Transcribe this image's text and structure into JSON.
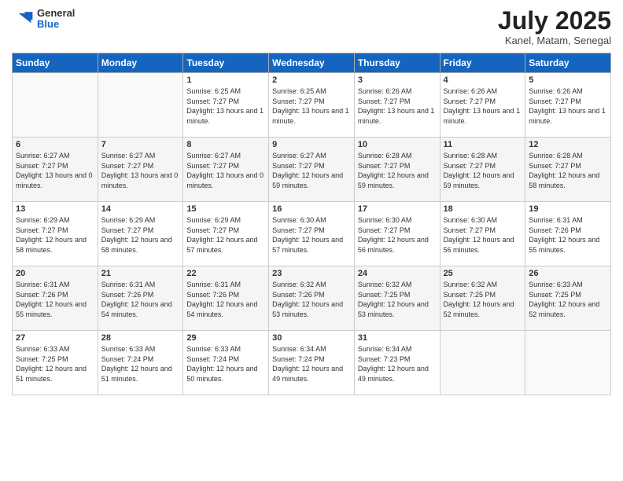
{
  "header": {
    "logo_general": "General",
    "logo_blue": "Blue",
    "month_title": "July 2025",
    "location": "Kanel, Matam, Senegal"
  },
  "weekdays": [
    "Sunday",
    "Monday",
    "Tuesday",
    "Wednesday",
    "Thursday",
    "Friday",
    "Saturday"
  ],
  "weeks": [
    [
      {
        "day": "",
        "info": ""
      },
      {
        "day": "",
        "info": ""
      },
      {
        "day": "1",
        "info": "Sunrise: 6:25 AM\nSunset: 7:27 PM\nDaylight: 13 hours and 1 minute."
      },
      {
        "day": "2",
        "info": "Sunrise: 6:25 AM\nSunset: 7:27 PM\nDaylight: 13 hours and 1 minute."
      },
      {
        "day": "3",
        "info": "Sunrise: 6:26 AM\nSunset: 7:27 PM\nDaylight: 13 hours and 1 minute."
      },
      {
        "day": "4",
        "info": "Sunrise: 6:26 AM\nSunset: 7:27 PM\nDaylight: 13 hours and 1 minute."
      },
      {
        "day": "5",
        "info": "Sunrise: 6:26 AM\nSunset: 7:27 PM\nDaylight: 13 hours and 1 minute."
      }
    ],
    [
      {
        "day": "6",
        "info": "Sunrise: 6:27 AM\nSunset: 7:27 PM\nDaylight: 13 hours and 0 minutes."
      },
      {
        "day": "7",
        "info": "Sunrise: 6:27 AM\nSunset: 7:27 PM\nDaylight: 13 hours and 0 minutes."
      },
      {
        "day": "8",
        "info": "Sunrise: 6:27 AM\nSunset: 7:27 PM\nDaylight: 13 hours and 0 minutes."
      },
      {
        "day": "9",
        "info": "Sunrise: 6:27 AM\nSunset: 7:27 PM\nDaylight: 12 hours and 59 minutes."
      },
      {
        "day": "10",
        "info": "Sunrise: 6:28 AM\nSunset: 7:27 PM\nDaylight: 12 hours and 59 minutes."
      },
      {
        "day": "11",
        "info": "Sunrise: 6:28 AM\nSunset: 7:27 PM\nDaylight: 12 hours and 59 minutes."
      },
      {
        "day": "12",
        "info": "Sunrise: 6:28 AM\nSunset: 7:27 PM\nDaylight: 12 hours and 58 minutes."
      }
    ],
    [
      {
        "day": "13",
        "info": "Sunrise: 6:29 AM\nSunset: 7:27 PM\nDaylight: 12 hours and 58 minutes."
      },
      {
        "day": "14",
        "info": "Sunrise: 6:29 AM\nSunset: 7:27 PM\nDaylight: 12 hours and 58 minutes."
      },
      {
        "day": "15",
        "info": "Sunrise: 6:29 AM\nSunset: 7:27 PM\nDaylight: 12 hours and 57 minutes."
      },
      {
        "day": "16",
        "info": "Sunrise: 6:30 AM\nSunset: 7:27 PM\nDaylight: 12 hours and 57 minutes."
      },
      {
        "day": "17",
        "info": "Sunrise: 6:30 AM\nSunset: 7:27 PM\nDaylight: 12 hours and 56 minutes."
      },
      {
        "day": "18",
        "info": "Sunrise: 6:30 AM\nSunset: 7:27 PM\nDaylight: 12 hours and 56 minutes."
      },
      {
        "day": "19",
        "info": "Sunrise: 6:31 AM\nSunset: 7:26 PM\nDaylight: 12 hours and 55 minutes."
      }
    ],
    [
      {
        "day": "20",
        "info": "Sunrise: 6:31 AM\nSunset: 7:26 PM\nDaylight: 12 hours and 55 minutes."
      },
      {
        "day": "21",
        "info": "Sunrise: 6:31 AM\nSunset: 7:26 PM\nDaylight: 12 hours and 54 minutes."
      },
      {
        "day": "22",
        "info": "Sunrise: 6:31 AM\nSunset: 7:26 PM\nDaylight: 12 hours and 54 minutes."
      },
      {
        "day": "23",
        "info": "Sunrise: 6:32 AM\nSunset: 7:26 PM\nDaylight: 12 hours and 53 minutes."
      },
      {
        "day": "24",
        "info": "Sunrise: 6:32 AM\nSunset: 7:25 PM\nDaylight: 12 hours and 53 minutes."
      },
      {
        "day": "25",
        "info": "Sunrise: 6:32 AM\nSunset: 7:25 PM\nDaylight: 12 hours and 52 minutes."
      },
      {
        "day": "26",
        "info": "Sunrise: 6:33 AM\nSunset: 7:25 PM\nDaylight: 12 hours and 52 minutes."
      }
    ],
    [
      {
        "day": "27",
        "info": "Sunrise: 6:33 AM\nSunset: 7:25 PM\nDaylight: 12 hours and 51 minutes."
      },
      {
        "day": "28",
        "info": "Sunrise: 6:33 AM\nSunset: 7:24 PM\nDaylight: 12 hours and 51 minutes."
      },
      {
        "day": "29",
        "info": "Sunrise: 6:33 AM\nSunset: 7:24 PM\nDaylight: 12 hours and 50 minutes."
      },
      {
        "day": "30",
        "info": "Sunrise: 6:34 AM\nSunset: 7:24 PM\nDaylight: 12 hours and 49 minutes."
      },
      {
        "day": "31",
        "info": "Sunrise: 6:34 AM\nSunset: 7:23 PM\nDaylight: 12 hours and 49 minutes."
      },
      {
        "day": "",
        "info": ""
      },
      {
        "day": "",
        "info": ""
      }
    ]
  ]
}
